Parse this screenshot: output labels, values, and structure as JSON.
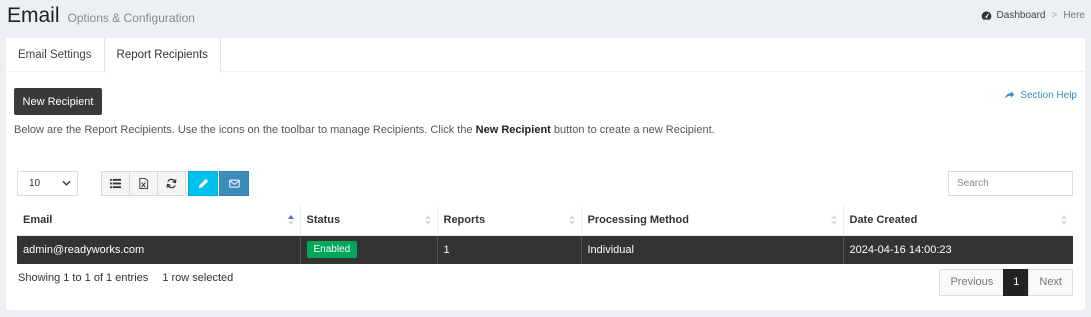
{
  "header": {
    "title": "Email",
    "subtitle": "Options & Configuration",
    "breadcrumb": {
      "dashboard": "Dashboard",
      "separator": ">",
      "current": "Here"
    }
  },
  "tabs": [
    {
      "label": "Email Settings",
      "active": false
    },
    {
      "label": "Report Recipients",
      "active": true
    }
  ],
  "actions": {
    "new_recipient": "New Recipient",
    "section_help": "Section Help"
  },
  "description": {
    "before": "Below are the Report Recipients. Use the icons on the toolbar to manage Recipients. Click the ",
    "bold": "New Recipient",
    "after": " button to create a new Recipient."
  },
  "table_controls": {
    "page_length": "10",
    "search_placeholder": "Search",
    "toolbar_icons": [
      "list-icon",
      "excel-export-icon",
      "refresh-icon",
      "edit-icon",
      "envelope-icon"
    ]
  },
  "table": {
    "columns": [
      "Email",
      "Status",
      "Reports",
      "Processing Method",
      "Date Created"
    ],
    "rows": [
      {
        "email": "admin@readyworks.com",
        "status": "Enabled",
        "reports": "1",
        "method": "Individual",
        "created": "2024-04-16 14:00:23",
        "selected": true
      }
    ]
  },
  "footer": {
    "info": "Showing 1 to 1 of 1 entries",
    "selected": "1 row selected",
    "pagination": {
      "previous": "Previous",
      "page": "1",
      "next": "Next"
    }
  },
  "colors": {
    "background": "#ecf0f5",
    "selected_row": "#333333",
    "enabled_badge": "#00a65a",
    "info_button": "#00c0ef",
    "primary_button": "#3c8dbc",
    "link": "#3c8dbc"
  }
}
